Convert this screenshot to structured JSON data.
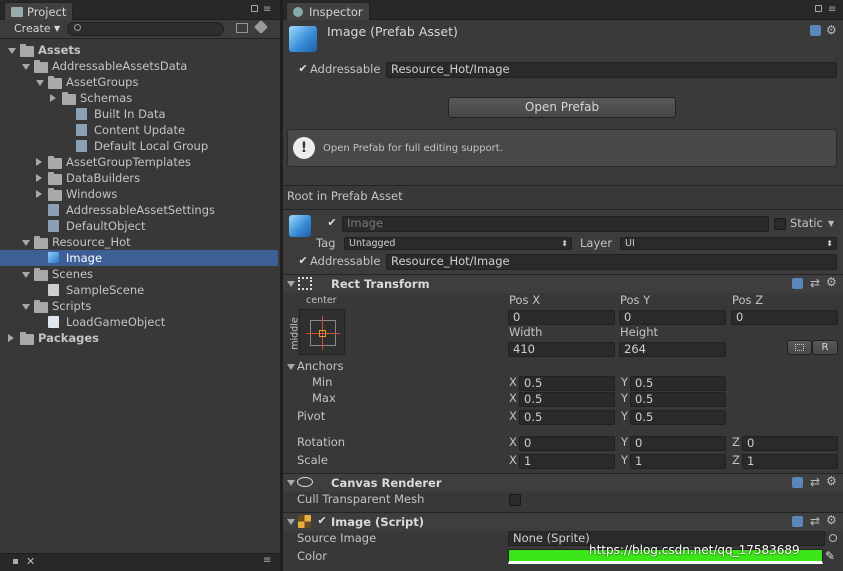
{
  "project": {
    "tab": "Project",
    "create_label": "Create",
    "tree": [
      {
        "label": "Assets",
        "kind": "folder",
        "bold": true
      },
      {
        "label": "AddressableAssetsData",
        "kind": "folder"
      },
      {
        "label": "AssetGroups",
        "kind": "folder"
      },
      {
        "label": "Schemas",
        "kind": "folder"
      },
      {
        "label": "Built In Data",
        "kind": "asset"
      },
      {
        "label": "Content Update",
        "kind": "asset"
      },
      {
        "label": "Default Local Group",
        "kind": "asset"
      },
      {
        "label": "AssetGroupTemplates",
        "kind": "folder"
      },
      {
        "label": "DataBuilders",
        "kind": "folder"
      },
      {
        "label": "Windows",
        "kind": "folder"
      },
      {
        "label": "AddressableAssetSettings",
        "kind": "asset"
      },
      {
        "label": "DefaultObject",
        "kind": "asset"
      },
      {
        "label": "Resource_Hot",
        "kind": "folder"
      },
      {
        "label": "Image",
        "kind": "prefab"
      },
      {
        "label": "Scenes",
        "kind": "folder"
      },
      {
        "label": "SampleScene",
        "kind": "scene"
      },
      {
        "label": "Scripts",
        "kind": "folder"
      },
      {
        "label": "LoadGameObject",
        "kind": "script"
      },
      {
        "label": "Packages",
        "kind": "folder",
        "bold": true
      }
    ]
  },
  "inspector": {
    "tab": "Inspector",
    "title": "Image (Prefab Asset)",
    "addressable_label": "Addressable",
    "addressable_path": "Resource_Hot/Image",
    "open_prefab": "Open Prefab",
    "info_text": "Open Prefab for full editing support.",
    "root_label": "Root in Prefab Asset",
    "go_name": "Image",
    "static_label": "Static",
    "tag_label": "Tag",
    "tag_value": "Untagged",
    "layer_label": "Layer",
    "layer_value": "UI",
    "addressable2_label": "Addressable",
    "addressable2_path": "Resource_Hot/Image",
    "rect": {
      "title": "Rect Transform",
      "anchor_top": "center",
      "anchor_side": "middle",
      "posx_label": "Pos X",
      "posy_label": "Pos Y",
      "posz_label": "Pos Z",
      "posx": "0",
      "posy": "0",
      "posz": "0",
      "width_label": "Width",
      "height_label": "Height",
      "width": "410",
      "height": "264",
      "r_label": "R",
      "anchors_label": "Anchors",
      "min_label": "Min",
      "max_label": "Max",
      "pivot_label": "Pivot",
      "min_x": "0.5",
      "min_y": "0.5",
      "max_x": "0.5",
      "max_y": "0.5",
      "pivot_x": "0.5",
      "pivot_y": "0.5",
      "rotation_label": "Rotation",
      "scale_label": "Scale",
      "rot_x": "0",
      "rot_y": "0",
      "rot_z": "0",
      "scale_x": "1",
      "scale_y": "1",
      "scale_z": "1",
      "x": "X",
      "y": "Y",
      "z": "Z"
    },
    "canvas": {
      "title": "Canvas Renderer",
      "cull_label": "Cull Transparent Mesh"
    },
    "image": {
      "title": "Image (Script)",
      "source_label": "Source Image",
      "source_value": "None (Sprite)",
      "color_label": "Color",
      "color": "#3ce619"
    },
    "watermark": "https://blog.csdn.net/qq_17583689"
  }
}
